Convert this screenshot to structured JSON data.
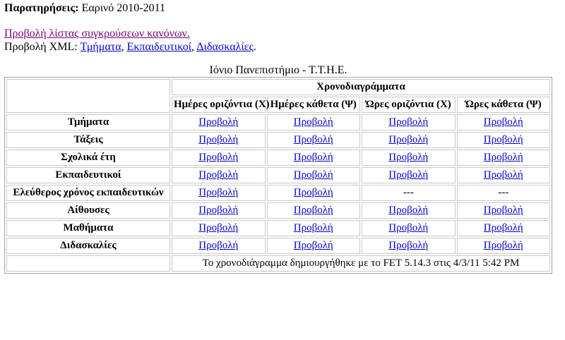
{
  "notes": {
    "label": "Παρατηρήσεις:",
    "value": " Εαρινό 2010-2011"
  },
  "conflicts_link": "Προβολή λίστας συγκρούσεων κανόνων.",
  "xml_view": {
    "prefix": "Προβολή XML: ",
    "links": [
      "Τμήματα",
      "Εκπαιδευτικοί",
      "Διδασκαλίες"
    ],
    "separator": ", ",
    "suffix": "."
  },
  "table": {
    "caption": "Ιόνιο Πανεπιστήμιο - Τ.Τ.Η.Ε.",
    "group_header": "Χρονοδιαγράμματα",
    "columns": [
      "Ημέρες οριζόντια (Χ)",
      "Ημέρες κάθετα (Ψ)",
      "Ώρες οριζόντια (Χ)",
      "Ώρες κάθετα (Ψ)"
    ],
    "rows": [
      {
        "label": "Τμήματα",
        "cells": [
          "Προβολή",
          "Προβολή",
          "Προβολή",
          "Προβολή"
        ]
      },
      {
        "label": "Τάξεις",
        "cells": [
          "Προβολή",
          "Προβολή",
          "Προβολή",
          "Προβολή"
        ]
      },
      {
        "label": "Σχολικά έτη",
        "cells": [
          "Προβολή",
          "Προβολή",
          "Προβολή",
          "Προβολή"
        ]
      },
      {
        "label": "Εκπαιδευτικοί",
        "cells": [
          "Προβολή",
          "Προβολή",
          "Προβολή",
          "Προβολή"
        ]
      },
      {
        "label": "Ελεύθερος χρόνος εκπαιδευτικών",
        "cells": [
          "Προβολή",
          "Προβολή",
          "---",
          "---"
        ]
      },
      {
        "label": "Αίθουσες",
        "cells": [
          "Προβολή",
          "Προβολή",
          "Προβολή",
          "Προβολή"
        ]
      },
      {
        "label": "Μαθήματα",
        "cells": [
          "Προβολή",
          "Προβολή",
          "Προβολή",
          "Προβολή"
        ]
      },
      {
        "label": "Διδασκαλίες",
        "cells": [
          "Προβολή",
          "Προβολή",
          "Προβολή",
          "Προβολή"
        ]
      }
    ],
    "footer": "Το χρονοδιάγραμμα δημιουργήθηκε με το FET 5.14.3 στις 4/3/11 5:42 PM"
  },
  "colors": {
    "link": "#0000cc",
    "visited_link": "#800080",
    "border": "#c8c8c8"
  }
}
